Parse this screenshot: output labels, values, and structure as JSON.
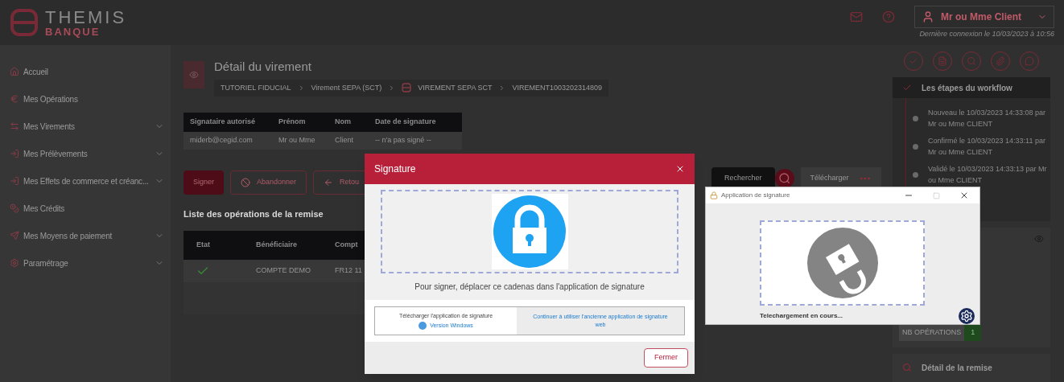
{
  "header": {
    "logo_title": "THEMIS",
    "logo_subtitle": "BANQUE",
    "user": "Mr ou Mme Client",
    "last_login": "Dernière connexion le 10/03/2023 à 10:56"
  },
  "sidebar": {
    "items": [
      {
        "kind": "home",
        "label": "Accueil",
        "has_submenu": false
      },
      {
        "kind": "euro",
        "label": "Mes Opérations",
        "has_submenu": false
      },
      {
        "kind": "transfer",
        "label": "Mes Virements",
        "has_submenu": true
      },
      {
        "kind": "debit",
        "label": "Mes Prélèvements",
        "has_submenu": true
      },
      {
        "kind": "debit",
        "label": "Mes Effets de commerce et créanc...",
        "has_submenu": true
      },
      {
        "kind": "credit",
        "label": "Mes Crédits",
        "has_submenu": false
      },
      {
        "kind": "payment",
        "label": "Mes Moyens de paiement",
        "has_submenu": true
      },
      {
        "kind": "settings",
        "label": "Paramétrage",
        "has_submenu": true
      }
    ]
  },
  "detail": {
    "title": "Détail du virement",
    "breadcrumb": [
      "TUTORIEL FIDUCIAL",
      "Virement SEPA (SCT)",
      "VIREMENT SEPA SCT",
      "VIREMENT1003202314809"
    ],
    "signers": {
      "columns": [
        "Signataire autorisé",
        "Prénom",
        "Nom",
        "Date de signature"
      ],
      "rows": [
        [
          "miderb@cegid.com",
          "Mr ou Mme",
          "Client",
          "-- n'a pas signé --"
        ]
      ]
    },
    "actions": [
      {
        "kind": "primary",
        "label": "Signer"
      },
      {
        "kind": "cancel",
        "label": "Abandonner"
      },
      {
        "kind": "back",
        "label": "Retou"
      }
    ],
    "search_button": "Rechercher",
    "download_button": "Télécharger",
    "list_title": "Liste des opérations de la remise",
    "operations": {
      "columns": [
        "Etat",
        "Bénéficiaire",
        "Compt"
      ],
      "rows": [
        {
          "ok": true,
          "cells": [
            "",
            "COMPTE DEMO",
            "FR12 11"
          ]
        }
      ]
    }
  },
  "workflow": {
    "title": "Les étapes du workflow",
    "steps": [
      "Nouveau le 10/03/2023 14:33:08 par Mr ou Mme CLIENT",
      "Confirmé le 10/03/2023 14:33:11 par Mr ou Mme CLIENT",
      "Validé le 10/03/2023 14:33:13 par Mr ou Mme CLIENT"
    ]
  },
  "summary": {
    "count_label": "NB OPÉRATIONS",
    "count": "1"
  },
  "remise": {
    "title": "Détail de la remise"
  },
  "signature_dialog": {
    "title": "Signature",
    "instruction": "Pour signer, déplacer ce cadenas dans l'application de signature",
    "download_label": "Télécharger l'application de signature",
    "download_link": "Version Windows",
    "legacy_link": "Continuer à utiliser l'ancienne application de signature web",
    "close_button": "Fermer"
  },
  "app_window": {
    "title": "Application de signature",
    "status": "Telechargement en cours..."
  }
}
